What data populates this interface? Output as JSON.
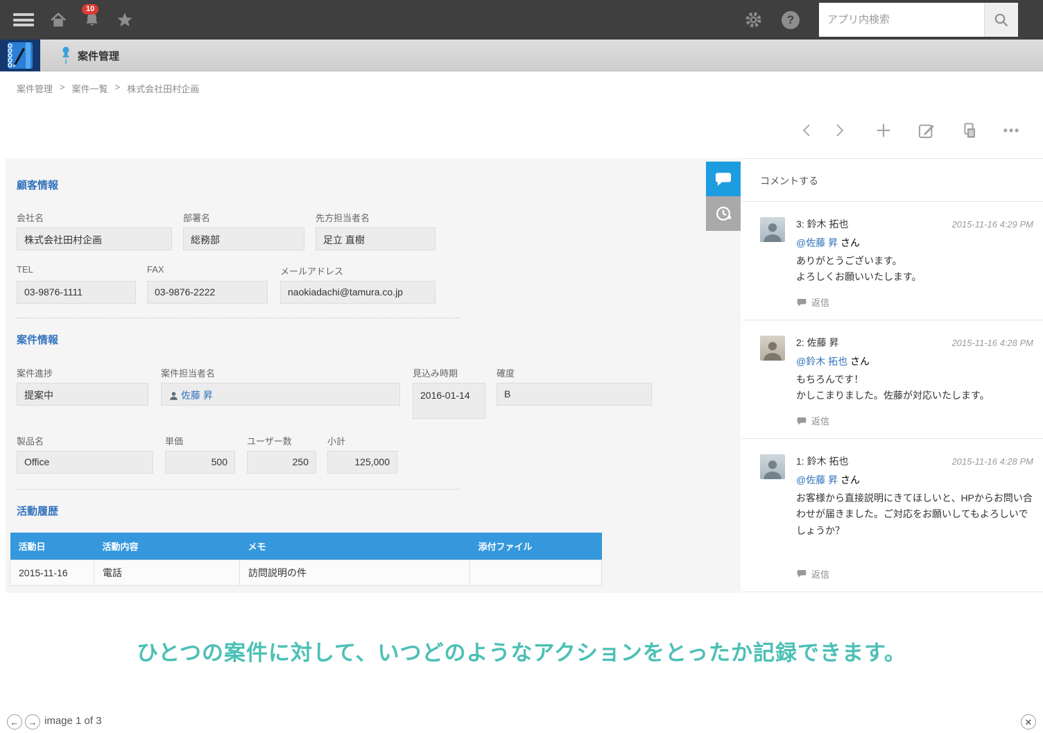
{
  "nav": {
    "notification_count": "10",
    "search_placeholder": "アプリ内検索"
  },
  "app_header": {
    "title": "案件管理"
  },
  "breadcrumb": {
    "items": [
      "案件管理",
      "案件一覧",
      "株式会社田村企画"
    ],
    "separator": ">"
  },
  "customer": {
    "title": "顧客情報",
    "company_label": "会社名",
    "company_value": "株式会社田村企画",
    "dept_label": "部署名",
    "dept_value": "総務部",
    "contact_label": "先方担当者名",
    "contact_value": "足立 直樹",
    "tel_label": "TEL",
    "tel_value": "03-9876-1111",
    "fax_label": "FAX",
    "fax_value": "03-9876-2222",
    "email_label": "メールアドレス",
    "email_value": "naokiadachi@tamura.co.jp"
  },
  "case": {
    "title": "案件情報",
    "progress_label": "案件進捗",
    "progress_value": "提案中",
    "owner_label": "案件担当者名",
    "owner_value": "佐藤 昇",
    "forecast_label": "見込み時期",
    "forecast_value": "2016-01-14",
    "probability_label": "確度",
    "probability_value": "B",
    "product_label": "製品名",
    "product_value": "Office",
    "unit_price_label": "単価",
    "unit_price_value": "500",
    "users_label": "ユーザー数",
    "users_value": "250",
    "subtotal_label": "小計",
    "subtotal_value": "125,000"
  },
  "activity": {
    "title": "活動履歴",
    "columns": [
      "活動日",
      "活動内容",
      "メモ",
      "添付ファイル"
    ],
    "rows": [
      [
        "2015-11-16",
        "電話",
        "訪問説明の件",
        ""
      ]
    ]
  },
  "comments": {
    "compose_label": "コメントする",
    "reply_label": "返信",
    "mention_suffix": " さん",
    "items": [
      {
        "name": "3: 鈴木 拓也",
        "time": "2015-11-16 4:29 PM",
        "mention": "@佐藤 昇",
        "body": [
          "ありがとうございます。",
          "よろしくお願いいたします。"
        ]
      },
      {
        "name": "2: 佐藤 昇",
        "time": "2015-11-16 4:28 PM",
        "mention": "@鈴木 拓也",
        "body": [
          "もちろんです！",
          "かしこまりました。佐藤が対応いたします。"
        ]
      },
      {
        "name": "1: 鈴木 拓也",
        "time": "2015-11-16 4:28 PM",
        "mention": "@佐藤 昇",
        "body": [
          "お客様から直接説明にきてほしいと、HPからお問い合わせが届きました。ご対応をお願いしてもよろしいでしょうか？"
        ]
      }
    ]
  },
  "caption": "ひとつの案件に対して、いつどのようなアクションをとったか記録できます。",
  "pager": {
    "label": "image 1 of 3"
  },
  "colors": {
    "nav_bg": "#3f3f3f",
    "accent_blue": "#3598dc",
    "section_blue": "#3473bd",
    "link_blue": "#3173bb",
    "tab_blue": "#1e9ce0",
    "badge_red": "#d93a32",
    "caption_teal": "#4cc0b5"
  }
}
